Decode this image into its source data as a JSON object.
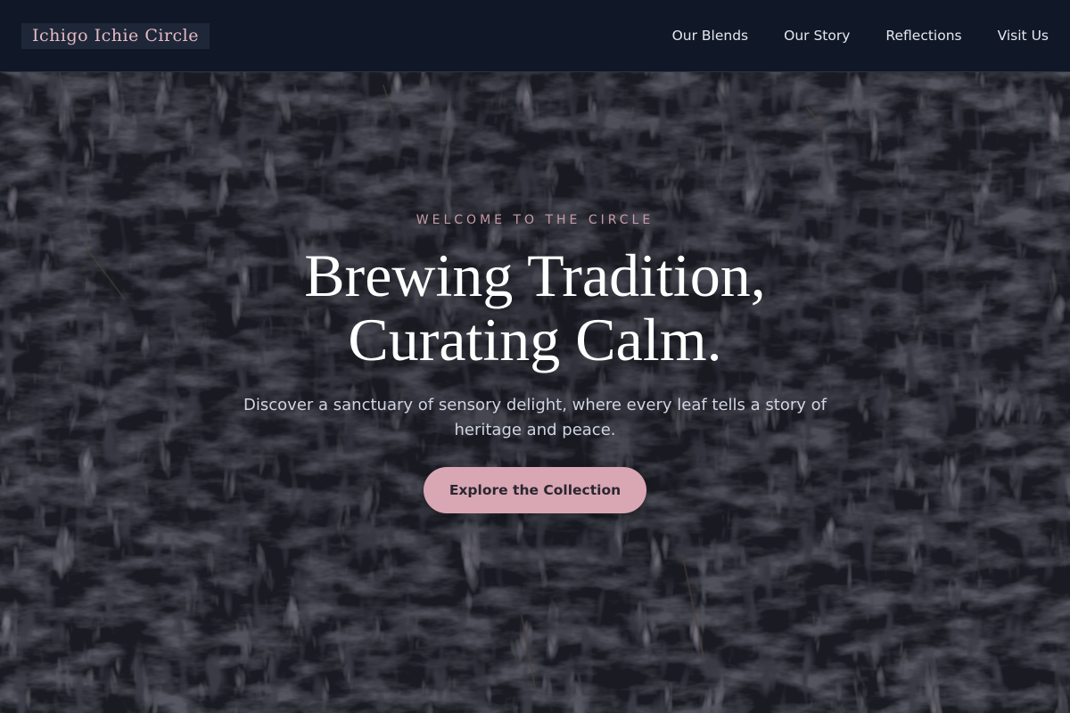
{
  "brand": {
    "name": "Ichigo Ichie Circle"
  },
  "nav": {
    "links": [
      {
        "label": "Our Blends"
      },
      {
        "label": "Our Story"
      },
      {
        "label": "Reflections"
      },
      {
        "label": "Visit Us"
      }
    ]
  },
  "hero": {
    "eyebrow": "WELCOME TO THE CIRCLE",
    "headline_line1": "Brewing Tradition,",
    "headline_line2": "Curating Calm.",
    "subtext": "Discover a sanctuary of sensory delight, where every leaf tells a story of heritage and peace.",
    "cta_label": "Explore the Collection",
    "background": "dark loose-leaf tea texture"
  },
  "colors": {
    "nav_bg": "#101828",
    "logo_text": "#e7b9c3",
    "accent_pink": "#d8a7b3",
    "eyebrow": "#c79aa6",
    "headline": "#ffffff"
  }
}
